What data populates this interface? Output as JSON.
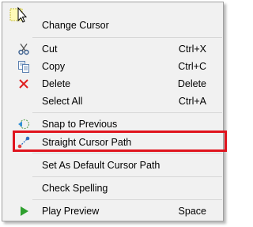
{
  "context_menu": {
    "items": [
      {
        "label": "Change Cursor",
        "shortcut": ""
      },
      {
        "label": "Cut",
        "shortcut": "Ctrl+X"
      },
      {
        "label": "Copy",
        "shortcut": "Ctrl+C"
      },
      {
        "label": "Delete",
        "shortcut": "Delete"
      },
      {
        "label": "Select All",
        "shortcut": "Ctrl+A"
      },
      {
        "label": "Snap to Previous",
        "shortcut": ""
      },
      {
        "label": "Straight Cursor Path",
        "shortcut": ""
      },
      {
        "label": "Set As Default Cursor Path",
        "shortcut": ""
      },
      {
        "label": "Check Spelling",
        "shortcut": ""
      },
      {
        "label": "Play Preview",
        "shortcut": "Space"
      }
    ],
    "highlighted_item": "Straight Cursor Path",
    "colors": {
      "menu_background": "#f1f1f1",
      "highlight_border": "#e0141e",
      "delete_icon": "#e02020",
      "play_icon": "#2fa02f"
    }
  }
}
